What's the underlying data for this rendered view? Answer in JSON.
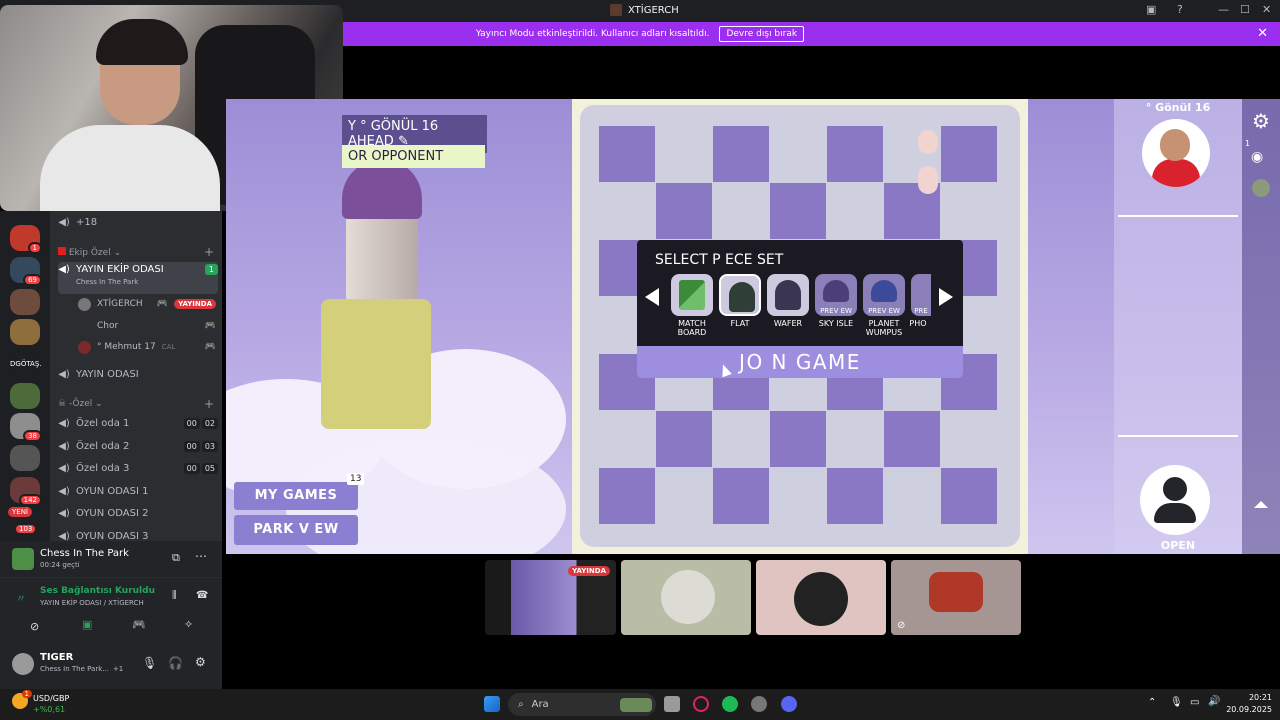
{
  "window": {
    "title": "XTİGERCH"
  },
  "notice": {
    "text": "Yayıncı Modu etkinleştirildi. Kullanıcı adları kısaltıldı.",
    "button": "Devre dışı bırak"
  },
  "servers": {
    "badges": [
      "1",
      "69",
      "38",
      "142",
      "103"
    ],
    "new_label": "YENİ",
    "text_server": "DGÖTAŞ."
  },
  "channels": {
    "overflow_count": "+18",
    "category_team": "Ekip Özel",
    "active_channel": {
      "name": "YAYIN EKİP ODASI",
      "activity": "Chess In The Park",
      "count": "1"
    },
    "users": [
      {
        "name": "XTİGERCH",
        "badge": "YAYINDA"
      },
      {
        "name": "Chor"
      },
      {
        "name": "° Mehmut 17",
        "extra": "CAL"
      }
    ],
    "yayin_odasi": "YAYIN ODASI",
    "category_private": "-Özel",
    "private_rooms": [
      {
        "name": "Özel oda 1",
        "a": "00",
        "b": "02"
      },
      {
        "name": "Özel oda 2",
        "a": "00",
        "b": "03"
      },
      {
        "name": "Özel oda 3",
        "a": "00",
        "b": "05"
      }
    ],
    "game_rooms": [
      "OYUN ODASI 1",
      "OYUN ODASI 2",
      "OYUN ODASI 3"
    ]
  },
  "activity": {
    "name": "Chess In The Park",
    "elapsed": "00:24 geçti"
  },
  "voice": {
    "status": "Ses Bağlantısı Kuruldu",
    "location": "YAYIN EKİP ODASI / XTİGERCH"
  },
  "user": {
    "name": "TIGER",
    "status": "Chess In The Park...",
    "plus": "+1"
  },
  "game": {
    "banner_top": "Y ° GÖNÜL 16 AHEAD",
    "banner_bottom": "OR OPPONENT",
    "my_games": "MY GAMES",
    "my_games_count": "13",
    "park_view": "PARK V EW",
    "select_title": "SELECT P ECE SET",
    "pieces": [
      {
        "label": "MATCH BOARD",
        "preview": ""
      },
      {
        "label": "FLAT",
        "preview": ""
      },
      {
        "label": "WAFER",
        "preview": ""
      },
      {
        "label": "SKY ISLE",
        "preview": "PREV EW"
      },
      {
        "label": "PLANET WUMPUS",
        "preview": "PREV EW"
      },
      {
        "label": "PHO",
        "preview": "PRE"
      }
    ],
    "join": "JO N GAME",
    "opponent": "° Gönül 16",
    "open_label": "OPEN",
    "rail_count": "1"
  },
  "thumbnails": {
    "live_badge": "YAYINDA"
  },
  "taskbar": {
    "ticker_name": "USD/GBP",
    "ticker_change": "+%0,61",
    "ticker_badge": "1",
    "search_placeholder": "Ara",
    "time": "20:21",
    "date": "20.09.2025"
  },
  "colors": {
    "accent": "#9b2ff0",
    "live": "#da373c",
    "board_dark": "#8a78c4",
    "board_light": "#cfd0df"
  }
}
